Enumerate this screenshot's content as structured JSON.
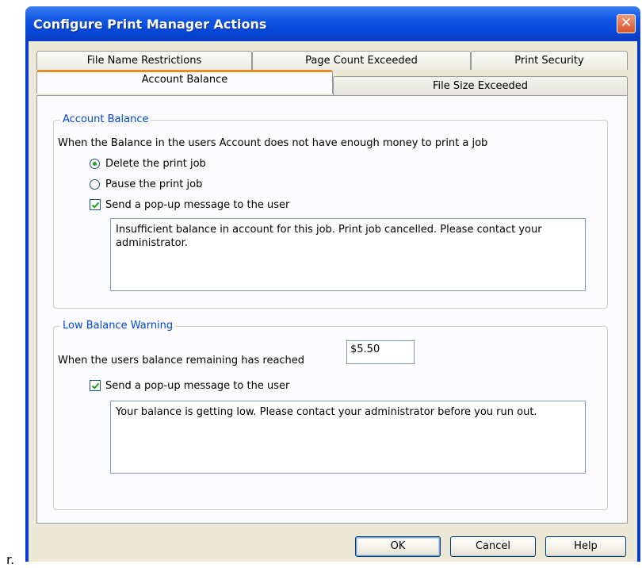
{
  "window": {
    "title": "Configure Print Manager Actions",
    "close_glyph": "✕"
  },
  "tabs": {
    "back_row": [
      "File Name Restrictions",
      "Page Count Exceeded",
      "Print Security"
    ],
    "front_row": [
      "Account Balance",
      "File Size Exceeded"
    ],
    "active": "Account Balance"
  },
  "account_balance": {
    "legend": "Account Balance",
    "description": "When the Balance in the users Account does not have enough money to print a job",
    "options": [
      {
        "label": "Delete the print job",
        "selected": true
      },
      {
        "label": "Pause the print job",
        "selected": false
      }
    ],
    "popup_checkbox": {
      "label": "Send a pop-up message to the user",
      "checked": true
    },
    "message": "Insufficient balance in account for this job. Print job cancelled. Please contact your administrator."
  },
  "low_balance": {
    "legend": "Low Balance Warning",
    "threshold_label": "When the users balance remaining has reached",
    "threshold_value": "$5.50",
    "popup_checkbox": {
      "label": "Send a pop-up message to the user",
      "checked": true
    },
    "message": "Your balance is getting low.  Please contact your administrator before you run out."
  },
  "buttons": {
    "ok": "OK",
    "cancel": "Cancel",
    "help": "Help"
  },
  "stray_text": "r.",
  "colors": {
    "titlebar": "#0648d8",
    "accent_tab": "#e68b2c",
    "group_legend": "#0046d5",
    "dialog_bg": "#ece9d8"
  },
  "icons": {
    "close": "close-icon",
    "checkmark": "checkmark-icon"
  }
}
